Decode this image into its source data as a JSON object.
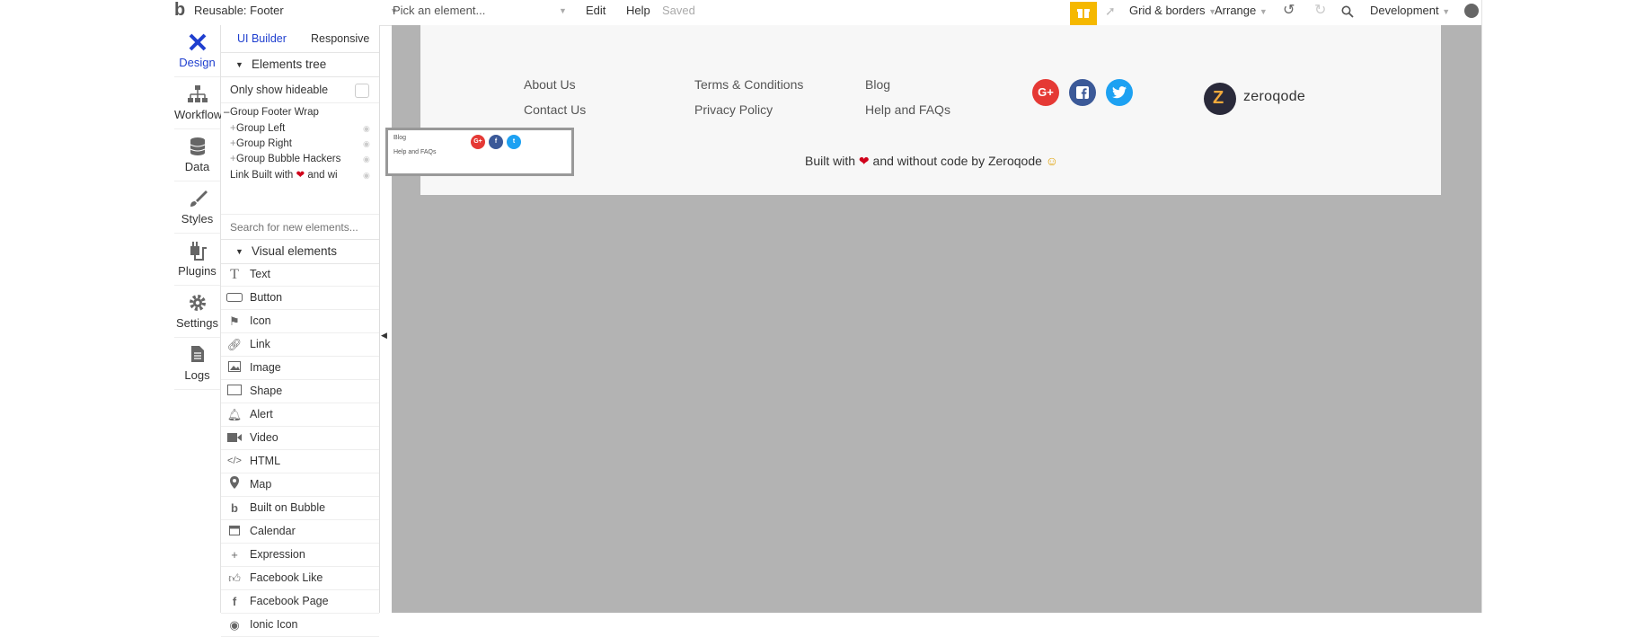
{
  "topbar": {
    "logo": "b",
    "page_name": "Reusable: Footer",
    "element_placeholder": "Pick an element...",
    "edit": "Edit",
    "help": "Help",
    "saved": "Saved",
    "grid": "Grid & borders",
    "arrange": "Arrange",
    "env": "Development"
  },
  "nav": {
    "design": "Design",
    "workflow": "Workflow",
    "data": "Data",
    "styles": "Styles",
    "plugins": "Plugins",
    "settings": "Settings",
    "logs": "Logs"
  },
  "panel": {
    "tab_ui": "UI Builder",
    "tab_responsive": "Responsive",
    "elements_tree": "Elements tree",
    "only_hideable": "Only show hideable",
    "tree": {
      "wrap": "Group Footer Wrap",
      "left": "Group Left",
      "right": "Group Right",
      "hackers": "Group Bubble Hackers",
      "link_a": "Link Built with",
      "link_b": "and wi"
    },
    "search_placeholder": "Search for new elements...",
    "visual_elements": "Visual elements",
    "elements": {
      "text": "Text",
      "button": "Button",
      "icon": "Icon",
      "link": "Link",
      "image": "Image",
      "shape": "Shape",
      "alert": "Alert",
      "video": "Video",
      "html": "HTML",
      "map": "Map",
      "built_on_bubble": "Built on Bubble",
      "calendar": "Calendar",
      "expression": "Expression",
      "facebook_like": "Facebook Like",
      "facebook_page": "Facebook Page",
      "ionic_icon": "Ionic Icon"
    }
  },
  "footer": {
    "about": "About Us",
    "contact": "Contact Us",
    "terms": "Terms & Conditions",
    "privacy": "Privacy Policy",
    "blog": "Blog",
    "help_faq": "Help and FAQs",
    "brand": "zeroqode",
    "built_a": "Built with",
    "built_b": "and without code by Zeroqode",
    "gplus": "G+",
    "facebook": "f",
    "colors": {
      "gplus": "#e53935",
      "facebook": "#3b5998",
      "twitter": "#1da1f2"
    }
  },
  "popup": {
    "blog": "Blog",
    "help": "Help and FAQs"
  }
}
